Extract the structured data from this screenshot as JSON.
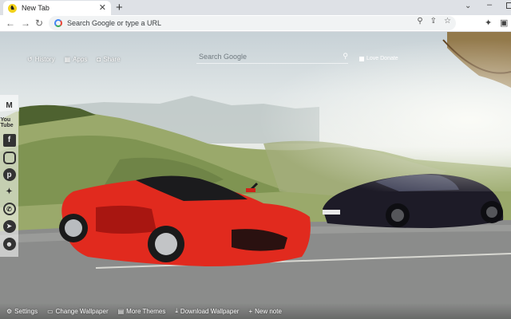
{
  "browser": {
    "tab_title": "New Tab",
    "tab_favicon": "prancing-horse-favicon",
    "newtab_glyph": "+",
    "omnibox_placeholder": "Search Google or type a URL"
  },
  "page": {
    "top_links": [
      {
        "label": "History",
        "icon": "history-icon"
      },
      {
        "label": "Apps",
        "icon": "apps-grid-icon"
      },
      {
        "label": "Share",
        "icon": "share-icon"
      }
    ],
    "search_placeholder": "Search Google",
    "donate_label": "Love Donate",
    "social_icons": [
      "gmail-icon",
      "youtube-icon",
      "facebook-icon",
      "instagram-icon",
      "pinterest-icon",
      "twitter-icon",
      "whatsapp-icon",
      "telegram-icon",
      "reddit-icon"
    ],
    "youtube_text": "You Tube",
    "bottom": {
      "settings": "Settings",
      "change_wallpaper": "Change Wallpaper",
      "more_themes": "More Themes",
      "download_wallpaper": "Download Wallpaper",
      "new_note": "New note"
    },
    "wallpaper": {
      "plate_text": "P1 GTR",
      "red_car_color": "#e12a1e",
      "black_car_color": "#1d1b27"
    }
  }
}
